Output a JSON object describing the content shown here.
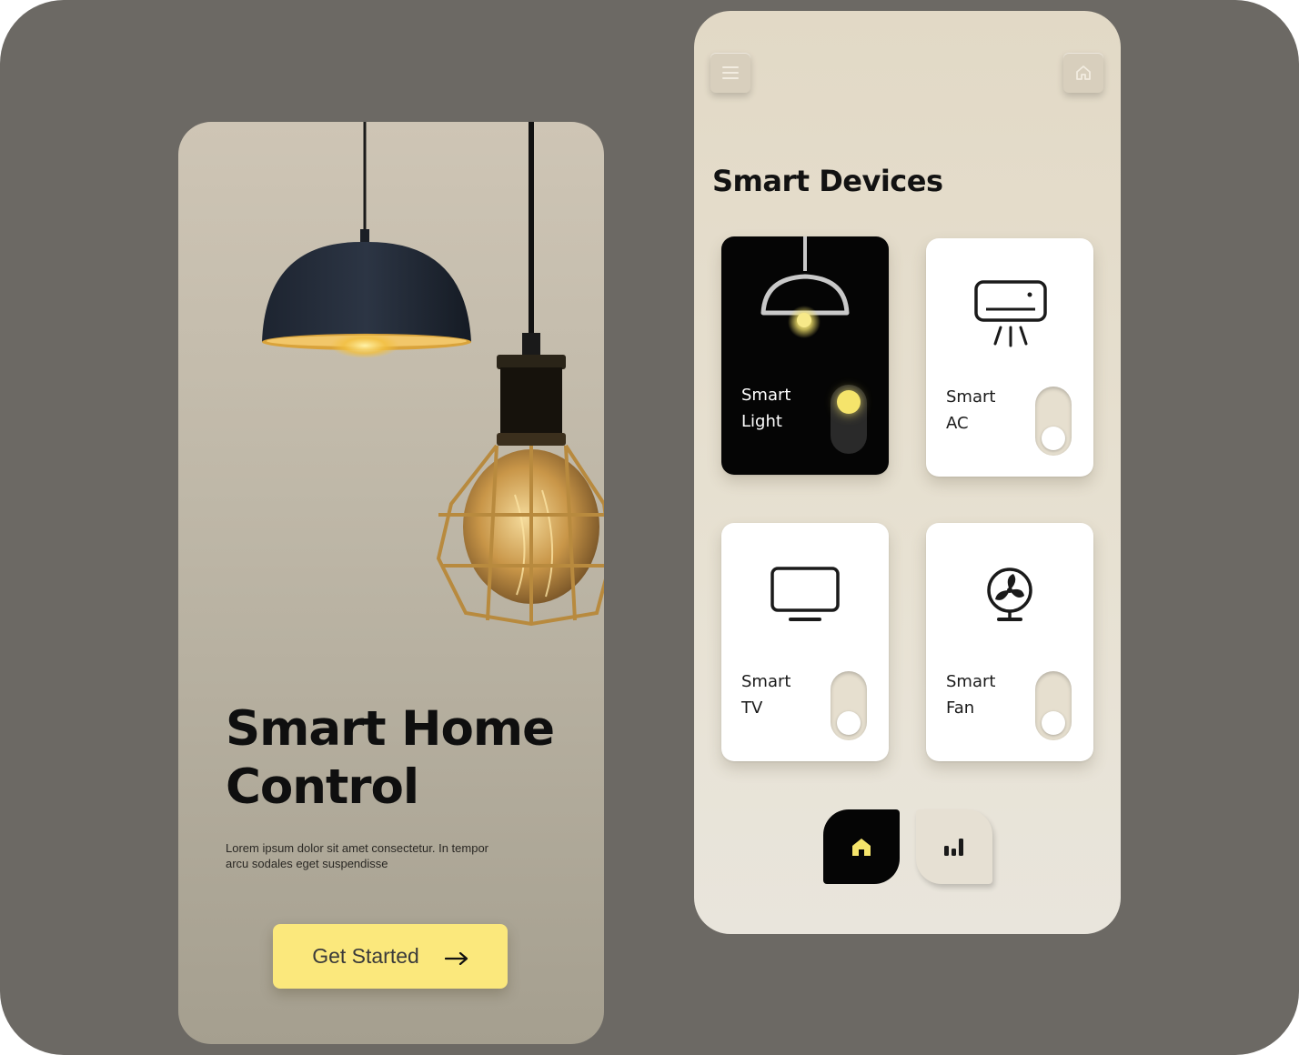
{
  "onboarding": {
    "title_line1": "Smart Home",
    "title_line2": "Control",
    "subtitle": "Lorem ipsum dolor sit amet consectetur. In tempor arcu sodales eget suspendisse",
    "cta_label": "Get Started",
    "cta_icon": "arrow-right-icon",
    "cta_color": "#fbe87c"
  },
  "dashboard": {
    "header": {
      "menu_icon": "menu-icon",
      "home_icon": "home-icon"
    },
    "section_title": "Smart Devices",
    "devices": [
      {
        "line1": "Smart",
        "line2": "Light",
        "icon": "pendant-lamp-icon",
        "on": true
      },
      {
        "line1": "Smart",
        "line2": "AC",
        "icon": "air-conditioner-icon",
        "on": false
      },
      {
        "line1": "Smart",
        "line2": "TV",
        "icon": "tv-icon",
        "on": false
      },
      {
        "line1": "Smart",
        "line2": "Fan",
        "icon": "fan-icon",
        "on": false
      }
    ],
    "bottom_nav": [
      {
        "icon": "home-icon",
        "active": true
      },
      {
        "icon": "bar-chart-icon",
        "active": false
      }
    ],
    "accent_color": "#f5e46b"
  },
  "colors": {
    "background": "#6c6964",
    "card_dark": "#050505",
    "card_light": "#ffffff"
  }
}
